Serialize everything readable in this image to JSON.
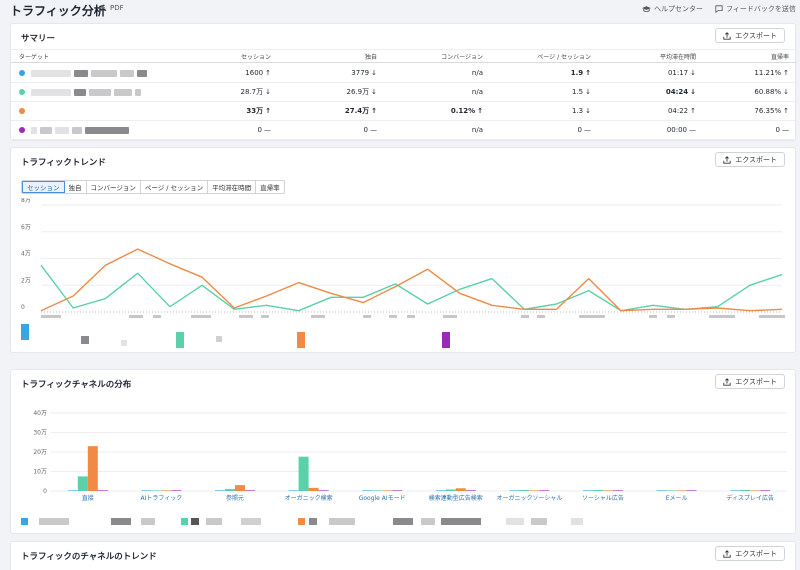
{
  "header": {
    "title": "トラフィック分析",
    "pdf_label": "PDF",
    "help_label": "ヘルプセンター",
    "feedback_label": "フィードバックを送信"
  },
  "export_label": "エクスポート",
  "summary": {
    "title": "サマリー",
    "columns": [
      "ターゲット",
      "セッション",
      "独自",
      "コンバージョン",
      "ページ / セッション",
      "平均滞在時間",
      "直帰率"
    ],
    "rows": [
      {
        "color": "#3aa3e3",
        "sessions": "1600",
        "sessions_dir": "up",
        "unique": "3779",
        "unique_dir": "down",
        "conv": "n/a",
        "pps": "1.9",
        "pps_dir": "up",
        "pps_bold": true,
        "time": "01:17",
        "time_dir": "down",
        "bounce": "11.21%",
        "bounce_dir": "up"
      },
      {
        "color": "#5ad1a8",
        "sessions": "28.7万",
        "sessions_dir": "down",
        "unique": "26.9万",
        "unique_dir": "down",
        "conv": "n/a",
        "pps": "1.5",
        "pps_dir": "down",
        "time": "04:24",
        "time_dir": "down",
        "time_bold": true,
        "bounce": "60.88%",
        "bounce_dir": "down"
      },
      {
        "color": "#f08a44",
        "sessions": "33万",
        "sessions_dir": "up",
        "sessions_bold": true,
        "unique": "27.4万",
        "unique_dir": "up",
        "unique_bold": true,
        "conv": "0.12%",
        "conv_dir": "up",
        "conv_bold": true,
        "pps": "1.3",
        "pps_dir": "down",
        "time": "04:22",
        "time_dir": "up",
        "bounce": "76.35%",
        "bounce_dir": "up"
      },
      {
        "color": "#9b2ab5",
        "sessions": "0",
        "sessions_dir": "flat",
        "unique": "0",
        "unique_dir": "flat",
        "conv": "n/a",
        "pps": "0",
        "pps_dir": "flat",
        "time": "00:00",
        "time_dir": "flat",
        "bounce": "0",
        "bounce_dir": "flat"
      }
    ]
  },
  "trend": {
    "title": "トラフィックトレンド",
    "tabs": [
      "セッション",
      "独自",
      "コンバージョン",
      "ページ / セッション",
      "平均滞在時間",
      "直帰率"
    ],
    "active_tab": 0
  },
  "channel": {
    "title": "トラフィックチャネルの分布"
  },
  "channel_trend": {
    "title": "トラフィックのチャネルのトレンド"
  },
  "chart_data": [
    {
      "type": "line",
      "yticks": [
        "0",
        "2万",
        "4万",
        "6万",
        "8万"
      ],
      "ylim": [
        0,
        80000
      ],
      "series": [
        {
          "color": "#5ad1a8",
          "values": [
            35000,
            3000,
            10000,
            29000,
            4000,
            20000,
            2000,
            5000,
            1000,
            11000,
            11000,
            21000,
            6000,
            17000,
            25000,
            2000,
            6000,
            16000,
            1000,
            5000,
            2000,
            4000,
            20000,
            28000
          ]
        },
        {
          "color": "#f08a44",
          "values": [
            1000,
            12000,
            35000,
            47000,
            36000,
            26000,
            3000,
            12000,
            22000,
            14000,
            7000,
            19000,
            32000,
            14000,
            5000,
            2000,
            2000,
            25000,
            1000,
            2000,
            2000,
            3000,
            1000,
            2000
          ]
        }
      ]
    },
    {
      "type": "bar",
      "yticks": [
        "0",
        "10万",
        "20万",
        "30万",
        "40万"
      ],
      "ylim": [
        0,
        400000
      ],
      "categories": [
        "直接",
        "AIトラフィック",
        "参照元",
        "オーガニック検索",
        "Google AIモード",
        "検索連動型広告検索",
        "オーガニックソーシャル",
        "ソーシャル広告",
        "Eメール",
        "ディスプレイ広告"
      ],
      "series": [
        {
          "color": "#3aa3e3",
          "values": [
            0,
            0,
            0,
            0,
            0,
            0,
            0,
            0,
            0,
            0
          ]
        },
        {
          "color": "#5ad1a8",
          "values": [
            75000,
            0,
            10000,
            176000,
            0,
            8000,
            3000,
            2000,
            0,
            2000
          ]
        },
        {
          "color": "#f08a44",
          "values": [
            230000,
            0,
            30000,
            16000,
            0,
            14000,
            0,
            0,
            0,
            0
          ]
        },
        {
          "color": "#9b2ab5",
          "values": [
            0,
            0,
            0,
            0,
            0,
            0,
            0,
            0,
            0,
            0
          ]
        }
      ]
    }
  ]
}
